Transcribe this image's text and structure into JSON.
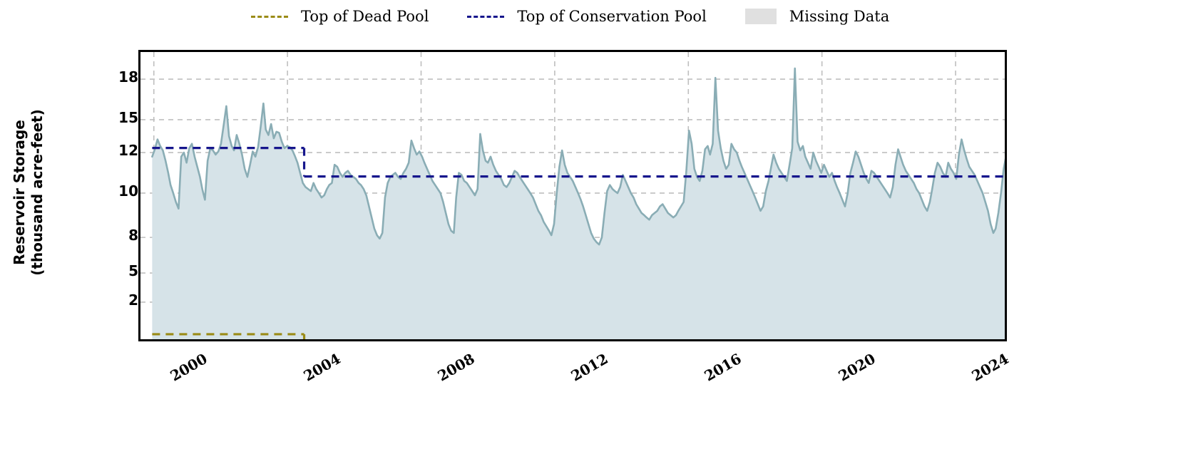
{
  "legend": {
    "items": [
      {
        "label": "Top of Dead Pool",
        "marker": "dashed-line",
        "color": "#9a8b16"
      },
      {
        "label": "Top of Conservation Pool",
        "marker": "dashed-line",
        "color": "#16168c"
      },
      {
        "label": "Missing Data",
        "marker": "filled-swatch",
        "color": "#e0e0e0"
      }
    ]
  },
  "axes": {
    "ylabel_line1": "Reservoir Storage",
    "ylabel_line2": "(thousand acre-feet)",
    "yticks": [
      2,
      5,
      8,
      10,
      12,
      15,
      18
    ],
    "ytick_labels": [
      "2",
      "5",
      "8",
      "10",
      "12",
      "15",
      "18"
    ],
    "xticks": [
      2000,
      2004,
      2008,
      2012,
      2016,
      2020,
      2024
    ],
    "xtick_labels": [
      "2000",
      "2004",
      "2008",
      "2012",
      "2016",
      "2020",
      "2024"
    ]
  },
  "colors": {
    "series_line": "#8aadb5",
    "series_fill": "#d6e3e8",
    "dead_pool": "#9a8b16",
    "conservation_pool": "#16168c",
    "missing_data": "#e0e0e0",
    "grid": "#bfbfbf",
    "frame": "#000000",
    "background": "#ffffff"
  },
  "chart_data": {
    "type": "area",
    "title": "",
    "xlabel": "",
    "ylabel": "Reservoir Storage (thousand acre-feet)",
    "xlim": [
      1999.6,
      2025.6
    ],
    "ylim": [
      0.0,
      19.9
    ],
    "grid": true,
    "legend_position": "above-top-center",
    "y_scale": "piecewise-linear-by-tick",
    "ytick_pixel_fractions": [
      0.858,
      0.758,
      0.636,
      0.484,
      0.345,
      0.232,
      0.093
    ],
    "series": [
      {
        "name": "Reservoir Storage",
        "type": "area",
        "line_color": "#8aadb5",
        "fill_color": "#d6e3e8",
        "x": [
          1999.95,
          2000.03,
          2000.11,
          2000.19,
          2000.27,
          2000.35,
          2000.43,
          2000.5,
          2000.58,
          2000.66,
          2000.74,
          2000.82,
          2000.9,
          2000.98,
          2001.06,
          2001.14,
          2001.22,
          2001.3,
          2001.38,
          2001.45,
          2001.53,
          2001.61,
          2001.69,
          2001.77,
          2001.85,
          2001.93,
          2002.01,
          2002.09,
          2002.17,
          2002.25,
          2002.33,
          2002.4,
          2002.48,
          2002.56,
          2002.64,
          2002.72,
          2002.8,
          2002.88,
          2002.96,
          2003.04,
          2003.12,
          2003.2,
          2003.28,
          2003.35,
          2003.43,
          2003.51,
          2003.59,
          2003.67,
          2003.75,
          2003.83,
          2003.91,
          2003.99,
          2004.07,
          2004.15,
          2004.23,
          2004.3,
          2004.38,
          2004.46,
          2004.54,
          2004.62,
          2004.7,
          2004.78,
          2004.86,
          2004.94,
          2005.02,
          2005.1,
          2005.18,
          2005.25,
          2005.33,
          2005.41,
          2005.49,
          2005.57,
          2005.65,
          2005.73,
          2005.81,
          2005.89,
          2005.97,
          2006.05,
          2006.13,
          2006.2,
          2006.28,
          2006.36,
          2006.44,
          2006.52,
          2006.6,
          2006.68,
          2006.76,
          2006.84,
          2006.92,
          2007.0,
          2007.08,
          2007.15,
          2007.23,
          2007.31,
          2007.39,
          2007.47,
          2007.55,
          2007.63,
          2007.71,
          2007.79,
          2007.87,
          2007.95,
          2008.03,
          2008.1,
          2008.18,
          2008.26,
          2008.34,
          2008.42,
          2008.5,
          2008.58,
          2008.66,
          2008.74,
          2008.82,
          2008.9,
          2008.98,
          2009.05,
          2009.13,
          2009.21,
          2009.29,
          2009.37,
          2009.45,
          2009.53,
          2009.61,
          2009.69,
          2009.77,
          2009.85,
          2009.93,
          2010.0,
          2010.08,
          2010.16,
          2010.24,
          2010.32,
          2010.4,
          2010.48,
          2010.56,
          2010.64,
          2010.72,
          2010.8,
          2010.88,
          2010.95,
          2011.03,
          2011.11,
          2011.19,
          2011.27,
          2011.35,
          2011.43,
          2011.51,
          2011.59,
          2011.67,
          2011.75,
          2011.83,
          2011.9,
          2011.98,
          2012.06,
          2012.14,
          2012.22,
          2012.3,
          2012.38,
          2012.46,
          2012.54,
          2012.62,
          2012.7,
          2012.78,
          2012.85,
          2012.93,
          2013.01,
          2013.09,
          2013.17,
          2013.25,
          2013.33,
          2013.41,
          2013.49,
          2013.57,
          2013.65,
          2013.73,
          2013.8,
          2013.88,
          2013.96,
          2014.04,
          2014.12,
          2014.2,
          2014.28,
          2014.36,
          2014.44,
          2014.52,
          2014.6,
          2014.68,
          2014.75,
          2014.83,
          2014.91,
          2014.99,
          2015.07,
          2015.15,
          2015.23,
          2015.31,
          2015.39,
          2015.47,
          2015.55,
          2015.63,
          2015.7,
          2015.78,
          2015.86,
          2015.94,
          2016.02,
          2016.1,
          2016.18,
          2016.26,
          2016.34,
          2016.42,
          2016.5,
          2016.58,
          2016.65,
          2016.73,
          2016.81,
          2016.89,
          2016.97,
          2017.05,
          2017.13,
          2017.21,
          2017.29,
          2017.37,
          2017.45,
          2017.53,
          2017.6,
          2017.68,
          2017.76,
          2017.84,
          2017.92,
          2018.0,
          2018.08,
          2018.16,
          2018.24,
          2018.32,
          2018.4,
          2018.48,
          2018.55,
          2018.63,
          2018.71,
          2018.79,
          2018.87,
          2018.95,
          2019.03,
          2019.11,
          2019.19,
          2019.27,
          2019.35,
          2019.43,
          2019.5,
          2019.58,
          2019.66,
          2019.74,
          2019.82,
          2019.9,
          2019.98,
          2020.06,
          2020.14,
          2020.22,
          2020.3,
          2020.38,
          2020.45,
          2020.53,
          2020.61,
          2020.69,
          2020.77,
          2020.85,
          2020.93,
          2021.01,
          2021.09,
          2021.17,
          2021.25,
          2021.33,
          2021.4,
          2021.48,
          2021.56,
          2021.64,
          2021.72,
          2021.8,
          2021.88,
          2021.96,
          2022.04,
          2022.12,
          2022.2,
          2022.28,
          2022.35,
          2022.43,
          2022.51,
          2022.59,
          2022.67,
          2022.75,
          2022.83,
          2022.91,
          2022.99,
          2023.07,
          2023.15,
          2023.23,
          2023.3,
          2023.38,
          2023.46,
          2023.54,
          2023.62,
          2023.7,
          2023.78,
          2023.86,
          2023.94,
          2024.02,
          2024.1,
          2024.18,
          2024.25,
          2024.33,
          2024.41,
          2024.49,
          2024.57,
          2024.65,
          2024.73,
          2024.81,
          2024.89,
          2024.97,
          2025.05,
          2025.13,
          2025.2,
          2025.28,
          2025.36,
          2025.44,
          2025.52
        ],
        "y": [
          11.8,
          12.3,
          13.2,
          12.6,
          12.2,
          11.6,
          11.0,
          10.4,
          10.0,
          9.6,
          9.3,
          11.8,
          12.0,
          11.5,
          12.4,
          12.8,
          11.8,
          11.3,
          10.8,
          10.2,
          9.7,
          11.6,
          12.4,
          12.2,
          11.9,
          12.1,
          12.8,
          14.5,
          16.0,
          13.5,
          12.6,
          12.2,
          13.6,
          12.8,
          11.9,
          11.2,
          10.8,
          11.4,
          12.1,
          11.8,
          12.5,
          14.4,
          16.2,
          14.1,
          13.6,
          14.6,
          13.3,
          13.9,
          13.8,
          13.0,
          12.4,
          12.6,
          12.5,
          12.2,
          11.8,
          11.5,
          11.0,
          10.5,
          10.3,
          10.2,
          10.1,
          10.5,
          10.2,
          10.0,
          9.8,
          9.9,
          10.2,
          10.4,
          10.5,
          11.4,
          11.3,
          11.0,
          10.8,
          11.0,
          11.1,
          10.9,
          10.8,
          10.7,
          10.5,
          10.4,
          10.2,
          9.9,
          9.4,
          8.9,
          8.4,
          8.1,
          7.9,
          8.2,
          9.8,
          10.5,
          10.8,
          10.9,
          11.0,
          10.8,
          10.7,
          11.0,
          11.2,
          11.5,
          13.1,
          12.4,
          11.9,
          12.1,
          11.8,
          11.5,
          11.2,
          10.9,
          10.6,
          10.4,
          10.2,
          10.0,
          9.6,
          9.1,
          8.6,
          8.3,
          8.2,
          9.8,
          11.0,
          10.9,
          10.6,
          10.5,
          10.3,
          10.1,
          9.9,
          10.2,
          13.7,
          12.2,
          11.6,
          11.5,
          11.8,
          11.4,
          11.1,
          10.9,
          10.7,
          10.4,
          10.3,
          10.5,
          10.8,
          11.1,
          11.0,
          10.8,
          10.6,
          10.4,
          10.2,
          10.0,
          9.8,
          9.5,
          9.2,
          9.0,
          8.7,
          8.5,
          8.3,
          8.1,
          8.6,
          10.0,
          11.3,
          12.2,
          11.4,
          11.0,
          10.8,
          10.6,
          10.3,
          10.0,
          9.7,
          9.4,
          9.0,
          8.6,
          8.2,
          7.9,
          7.6,
          7.4,
          8.0,
          9.1,
          10.1,
          10.4,
          10.2,
          10.1,
          10.0,
          10.3,
          10.9,
          10.6,
          10.3,
          10.0,
          9.8,
          9.5,
          9.3,
          9.1,
          9.0,
          8.9,
          8.8,
          9.0,
          9.1,
          9.2,
          9.4,
          9.5,
          9.3,
          9.1,
          9.0,
          8.9,
          9.0,
          9.2,
          9.4,
          9.6,
          11.1,
          14.0,
          12.8,
          11.2,
          10.8,
          10.6,
          11.1,
          12.3,
          12.6,
          11.9,
          12.8,
          18.1,
          14.0,
          12.4,
          11.6,
          11.2,
          11.4,
          12.8,
          12.3,
          12.0,
          11.6,
          11.3,
          11.0,
          10.7,
          10.4,
          10.1,
          9.8,
          9.5,
          9.2,
          9.4,
          10.1,
          10.6,
          11.3,
          11.9,
          11.5,
          11.2,
          11.0,
          10.8,
          10.6,
          11.4,
          12.4,
          18.8,
          13.0,
          12.2,
          12.6,
          11.8,
          11.5,
          11.2,
          12.0,
          11.6,
          11.3,
          11.0,
          11.4,
          11.1,
          10.8,
          11.0,
          10.6,
          10.3,
          10.0,
          9.7,
          9.4,
          10.0,
          11.0,
          11.5,
          12.1,
          11.8,
          11.4,
          11.0,
          10.7,
          10.5,
          11.1,
          11.0,
          10.8,
          10.6,
          10.4,
          10.2,
          10.0,
          9.8,
          10.3,
          11.4,
          12.3,
          11.8,
          11.4,
          11.1,
          10.9,
          10.7,
          10.5,
          10.2,
          10.0,
          9.7,
          9.4,
          9.2,
          9.6,
          10.2,
          11.0,
          11.5,
          11.3,
          11.0,
          10.8,
          11.5,
          11.2,
          11.0,
          10.7,
          11.9,
          13.2,
          12.3,
          11.7,
          11.3,
          11.1,
          10.9,
          10.6,
          10.3,
          10.0,
          9.6,
          9.2,
          8.6,
          8.2,
          8.4,
          9.1,
          10.0,
          11.2,
          11.9
        ]
      }
    ],
    "reference_lines": [
      {
        "name": "Top of Dead Pool",
        "color": "#9a8b16",
        "style": "dashed",
        "segments": [
          {
            "x_start": 1999.95,
            "x_end": 2004.5,
            "y": 0.45
          },
          {
            "x_start": 2004.5,
            "x_end": 2025.55,
            "y": 0.02
          }
        ]
      },
      {
        "name": "Top of Conservation Pool",
        "color": "#16168c",
        "style": "dashed",
        "segments": [
          {
            "x_start": 1999.95,
            "x_end": 2004.5,
            "y": 12.42
          },
          {
            "x_start": 2004.5,
            "x_end": 2025.55,
            "y": 10.82
          }
        ]
      }
    ],
    "missing_data_spans": []
  }
}
